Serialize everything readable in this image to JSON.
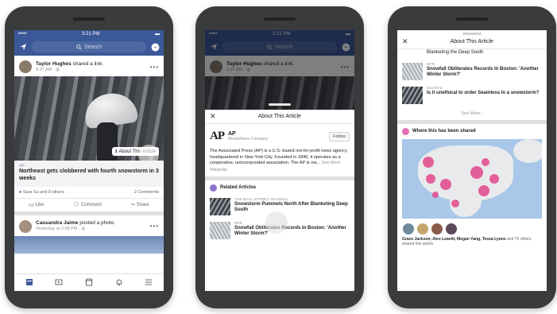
{
  "colors": {
    "fb_blue": "#3b5998",
    "heat_pink": "#e2478c"
  },
  "status_bar": {
    "time": "3:21 PM"
  },
  "header": {
    "search_placeholder": "Search"
  },
  "feed": {
    "post1": {
      "author": "Taylor Hughes",
      "action": "shared a link.",
      "time": "9:37 AM",
      "about_pill": "About This Article",
      "link_source": "AP",
      "link_title": "Northeast gets clobbered with fourth snowstorm in 3 weeks",
      "reactions": "Sara Su and 8 others",
      "comments": "2 Comments",
      "actions": [
        "Like",
        "Comment",
        "Share"
      ]
    },
    "post2": {
      "author": "Cassandra Jaime",
      "action": "posted a photo.",
      "time": "Yesterday at 2:08 PM"
    }
  },
  "sheet": {
    "title": "About This Article",
    "publisher": {
      "logo": "AP",
      "name": "AP",
      "type": "Media/News Company",
      "follow_label": "Follow"
    },
    "description": "The Associated Press (AP) is a U.S.-based not-for-profit news agency headquartered in New York City. Founded in 1846, it operates as a cooperative, unincorporated association. The AP is ow...",
    "see_more": "See More",
    "wiki_source": "Wikipedia",
    "related_heading": "Related Articles",
    "related": [
      {
        "source": "The Wall Street Journal",
        "title": "Snowstorm Pummels North After Blanketing Deep South"
      },
      {
        "source": "NPR",
        "title": "Snowfall Obliterates Records In Boston: 'Another Winter Storm?'"
      }
    ]
  },
  "phone3": {
    "title": "About This Article",
    "top_snippet": "Blanketing the Deep South",
    "related": [
      {
        "source": "NPR",
        "title": "Snowfall Obliterates Records In Boston: 'Another Winter Storm?'"
      },
      {
        "source": "Quartz",
        "title": "Is it unethical to order Seamless in a snowstorm?"
      }
    ],
    "see_more": "See More",
    "shared_heading": "Where this has been shared",
    "sharers_text_names": "Grace Jackson, Alex Leavitt, Megan Yang, Tessa Lyons",
    "sharers_text_rest": "and 75 others shared this article."
  }
}
